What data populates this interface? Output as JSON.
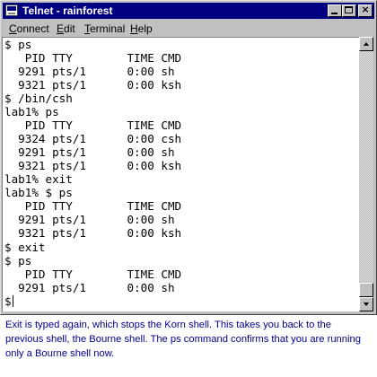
{
  "window": {
    "title": "Telnet - rainforest",
    "icon": "telnet-app-icon",
    "controls": {
      "minimize_icon": "minimize-icon",
      "maximize_icon": "maximize-icon",
      "close_glyph": "×"
    }
  },
  "menu": {
    "items": [
      {
        "accel": "C",
        "rest": "onnect"
      },
      {
        "accel": "E",
        "rest": "dit"
      },
      {
        "accel": "T",
        "rest": "erminal"
      },
      {
        "accel": "H",
        "rest": "elp"
      }
    ]
  },
  "terminal": {
    "lines": [
      "$ ps",
      "   PID TTY        TIME CMD",
      "  9291 pts/1      0:00 sh",
      "  9321 pts/1      0:00 ksh",
      "$ /bin/csh",
      "lab1% ps",
      "   PID TTY        TIME CMD",
      "  9324 pts/1      0:00 csh",
      "  9291 pts/1      0:00 sh",
      "  9321 pts/1      0:00 ksh",
      "lab1% exit",
      "lab1% $ ps",
      "   PID TTY        TIME CMD",
      "  9291 pts/1      0:00 sh",
      "  9321 pts/1      0:00 ksh",
      "$ exit",
      "$ ps",
      "   PID TTY        TIME CMD",
      "  9291 pts/1      0:00 sh",
      "$"
    ]
  },
  "caption": "Exit is typed again, which stops the Korn shell.  This takes you back to the previous shell, the Bourne shell.  The ps command confirms that you are running only a Bourne shell now.",
  "colors": {
    "titlebar": "#000080",
    "caption_text": "#00008b",
    "chrome": "#c0c0c0"
  }
}
